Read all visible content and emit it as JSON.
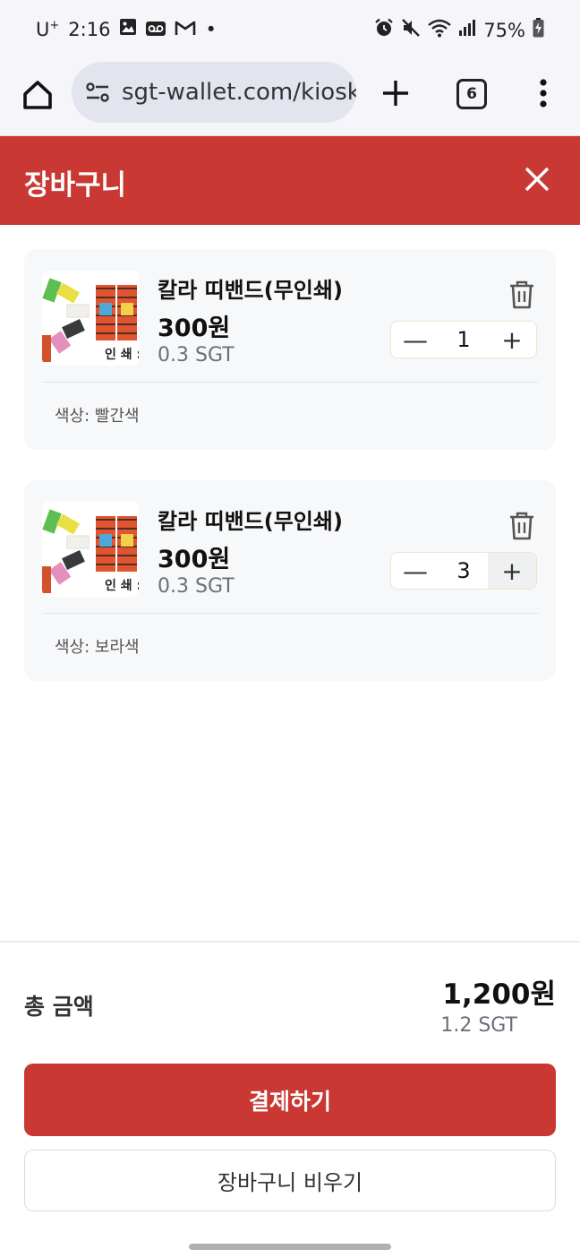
{
  "status_bar": {
    "carrier": "U",
    "carrier_sup": "+",
    "time": "2:16",
    "dot": "•",
    "battery": "75%",
    "icons_left": [
      "gallery-icon",
      "voicemail-icon",
      "gmail-icon"
    ],
    "icons_right": [
      "alarm-icon",
      "mute-icon",
      "wifi-icon",
      "signal-icon",
      "battery-icon"
    ]
  },
  "browser": {
    "url": "sgt-wallet.com/kiosk",
    "tab_count": "6"
  },
  "cart": {
    "title": "장바구니",
    "items": [
      {
        "name": "칼라 띠밴드(무인쇄)",
        "price": "300원",
        "sgt": "0.3 SGT",
        "quantity": "1",
        "option": "색상: 빨간색",
        "thumb_text": "인 쇄 :"
      },
      {
        "name": "칼라 띠밴드(무인쇄)",
        "price": "300원",
        "sgt": "0.3 SGT",
        "quantity": "3",
        "option": "색상: 보라색",
        "thumb_text": "인 쇄 :"
      }
    ],
    "step_minus": "—",
    "step_plus": "+"
  },
  "summary": {
    "total_label": "총 금액",
    "total_won": "1,200원",
    "total_sgt": "1.2 SGT"
  },
  "actions": {
    "pay_label": "결제하기",
    "clear_label": "장바구니 비우기"
  },
  "colors": {
    "brand_red": "#c93832",
    "card_bg": "#f7f8fa",
    "browser_bg": "#f5f5fa"
  }
}
